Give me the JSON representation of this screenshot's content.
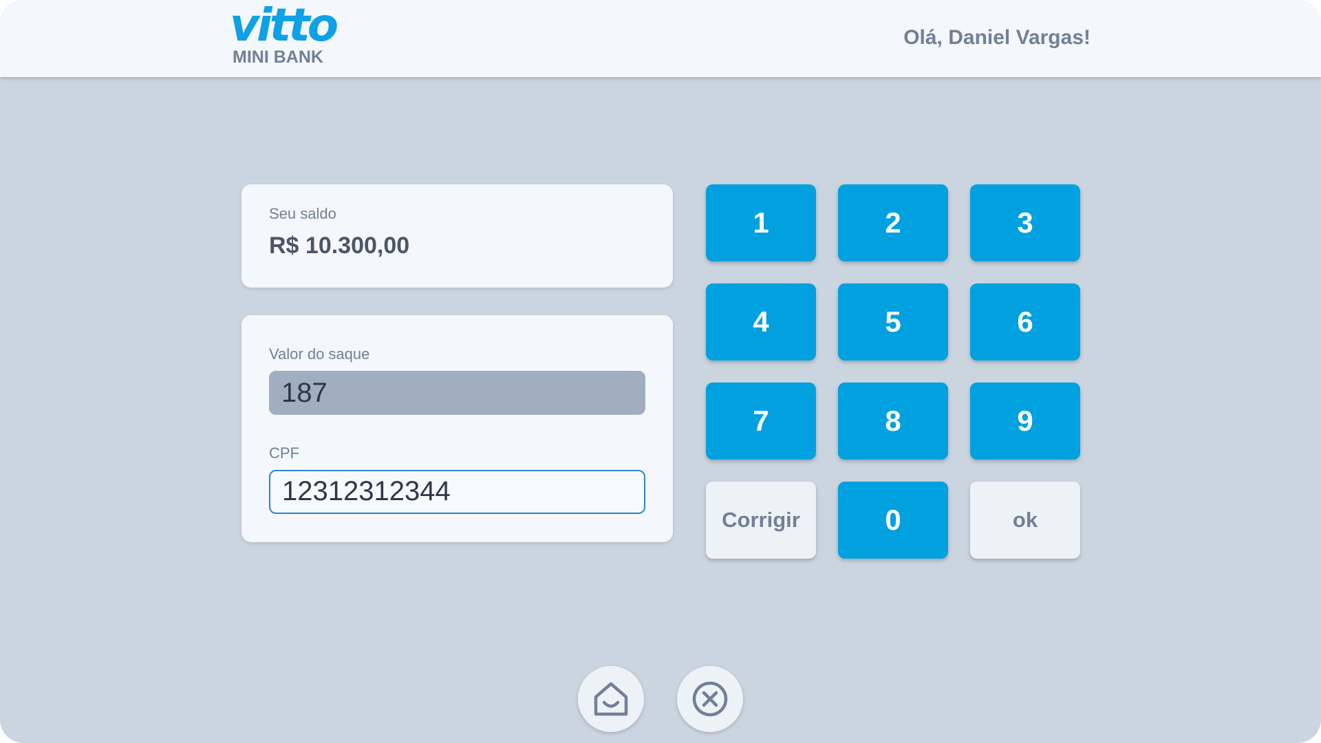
{
  "header": {
    "logo_word": "vitto",
    "logo_sub": "MINI BANK",
    "greeting": "Olá, Daniel Vargas!"
  },
  "balance": {
    "label": "Seu saldo",
    "value": "R$ 10.300,00"
  },
  "withdraw": {
    "amount_label": "Valor do saque",
    "amount_value": "187",
    "cpf_label": "CPF",
    "cpf_value": "12312312344"
  },
  "keypad": {
    "k1": "1",
    "k2": "2",
    "k3": "3",
    "k4": "4",
    "k5": "5",
    "k6": "6",
    "k7": "7",
    "k8": "8",
    "k9": "9",
    "correct": "Corrigir",
    "k0": "0",
    "ok": "ok"
  },
  "footer": {
    "home_icon": "home-icon",
    "cancel_icon": "close-circle-icon"
  },
  "colors": {
    "background": "#cbd5e0",
    "accent": "#00a1de",
    "brand": "#0ea1e6",
    "text_muted": "#718096",
    "text_dark": "#4a5568"
  }
}
